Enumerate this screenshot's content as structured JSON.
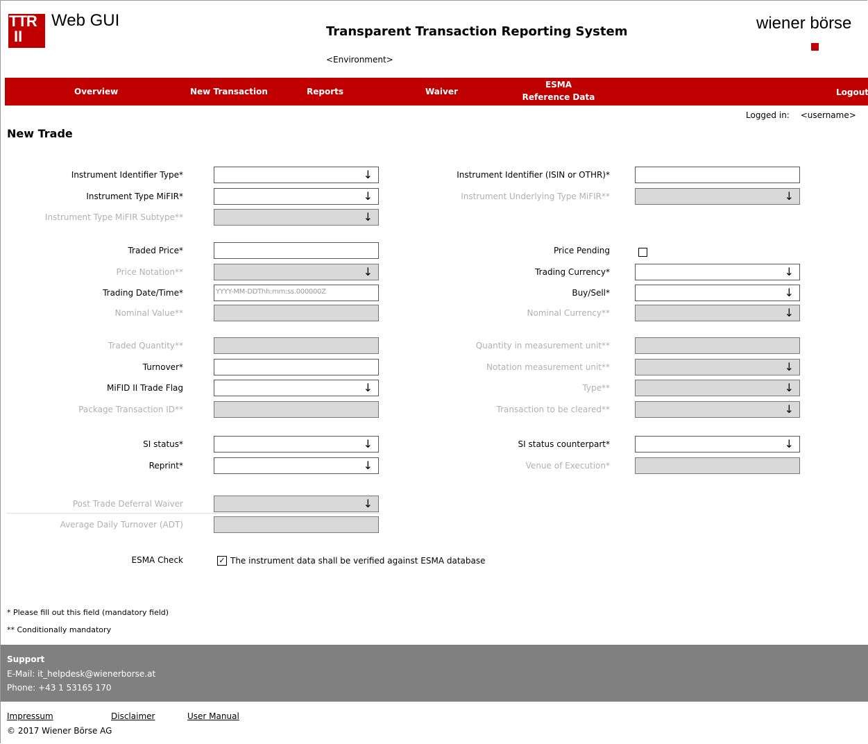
{
  "header": {
    "logo_line1": "TTR",
    "logo_line2": "II",
    "app_name": "Web GUI",
    "system_title": "Transparent Transaction Reporting System",
    "environment": "<Environment>",
    "brand_name": "wiener börse",
    "brand_color": "#c00000"
  },
  "nav": {
    "items": [
      "Overview",
      "New Transaction",
      "Reports",
      "Waiver"
    ],
    "esma_line1": "ESMA",
    "esma_line2": "Reference Data",
    "logout": "Logout"
  },
  "session": {
    "logged_in_label": "Logged in:",
    "username": "<username>"
  },
  "page_title": "New Trade",
  "labels": {
    "instrument_identifier_type": "Instrument Identifier Type*",
    "instrument_identifier": "Instrument Identifier (ISIN or OTHR)*",
    "instrument_type_mifir": "Instrument Type MiFIR*",
    "instrument_underlying_type": "Instrument Underlying Type MiFIR**",
    "instrument_type_subtype": "Instrument Type MiFIR Subtype**",
    "traded_price": "Traded Price*",
    "price_pending": "Price Pending",
    "price_notation": "Price Notation**",
    "trading_currency": "Trading Currency*",
    "trading_datetime": "Trading Date/Time*",
    "buy_sell": "Buy/Sell*",
    "nominal_value": "Nominal Value**",
    "nominal_currency": "Nominal Currency**",
    "traded_quantity": "Traded Quantity**",
    "quantity_measurement_unit": "Quantity in measurement unit**",
    "turnover": "Turnover*",
    "notation_measurement_unit": "Notation measurement unit**",
    "mifid_trade_flag": "MiFID II Trade Flag",
    "type": "Type**",
    "package_transaction_id": "Package Transaction ID**",
    "transaction_to_be_cleared": "Transaction to be cleared**",
    "si_status": "SI status*",
    "si_status_counterpart": "SI status counterpart*",
    "reprint": "Reprint*",
    "venue_of_execution": "Venue of Execution*",
    "post_trade_deferral_waiver": "Post Trade Deferral Waiver",
    "average_daily_turnover": "Average Daily Turnover (ADT)",
    "esma_check": "ESMA Check"
  },
  "fields": {
    "trading_datetime_placeholder": "YYYY-MM-DDThh:mm:ss.000000Z"
  },
  "esma_check_text": "The instrument data shall be verified against ESMA database",
  "notes": {
    "mandatory": "* Please fill out this field (mandatory field)",
    "conditional": "** Conditionally mandatory"
  },
  "support": {
    "title": "Support",
    "email": "E-Mail: it_helpdesk@wienerborse.at",
    "phone": "Phone: +43 1 53165 170"
  },
  "footer_links": {
    "impressum": "Impressum",
    "disclaimer": "Disclaimer",
    "user_manual": "User Manual"
  },
  "copyright": "© 2017 Wiener Börse AG",
  "icons": {
    "dropdown": "arrow-down-icon",
    "checkbox": "checkbox-icon"
  }
}
